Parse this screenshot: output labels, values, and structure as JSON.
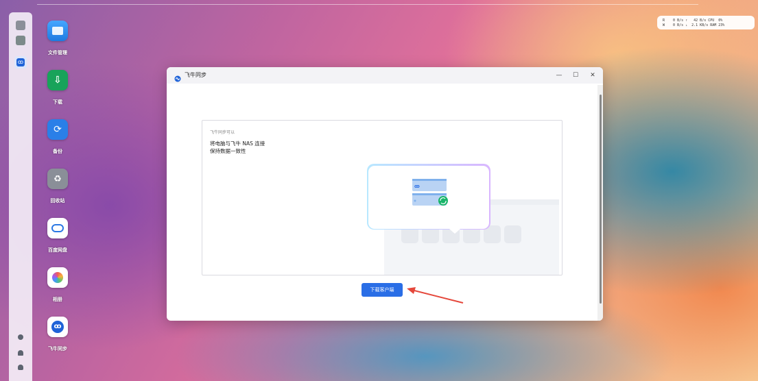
{
  "desktop": {
    "icons": [
      {
        "label": "文件管理",
        "icon": "folder-icon",
        "color": "#2e8ff0"
      },
      {
        "label": "下载",
        "icon": "download-icon",
        "color": "#18a35a"
      },
      {
        "label": "备份",
        "icon": "backup-icon",
        "color": "#2a7fe8"
      },
      {
        "label": "回收站",
        "icon": "recycle-bin-icon",
        "color": "#8a8f98"
      },
      {
        "label": "百度网盘",
        "icon": "baidu-netdisk-icon",
        "color": "#ffffff"
      },
      {
        "label": "相册",
        "icon": "photos-icon",
        "color": "#ffffff"
      },
      {
        "label": "飞牛同步",
        "icon": "feiniu-sync-icon",
        "color": "#ffffff"
      }
    ]
  },
  "stats": {
    "row1": "R    0 B/s ⇡   42 B/s CPU  0%",
    "row2": "W    0 B/s ⇣  2.1 KB/s RAM 23%"
  },
  "window": {
    "title": "飞牛同步",
    "minimize": "—",
    "maximize": "☐",
    "close": "✕",
    "intro_caption": "飞牛同步可以",
    "line1": "将电脑与飞牛 NAS 连接",
    "line2": "保持数据一致性",
    "download_button": "下载客户端"
  },
  "colors": {
    "accent": "#2a6ee6",
    "arrow": "#e5473b"
  }
}
